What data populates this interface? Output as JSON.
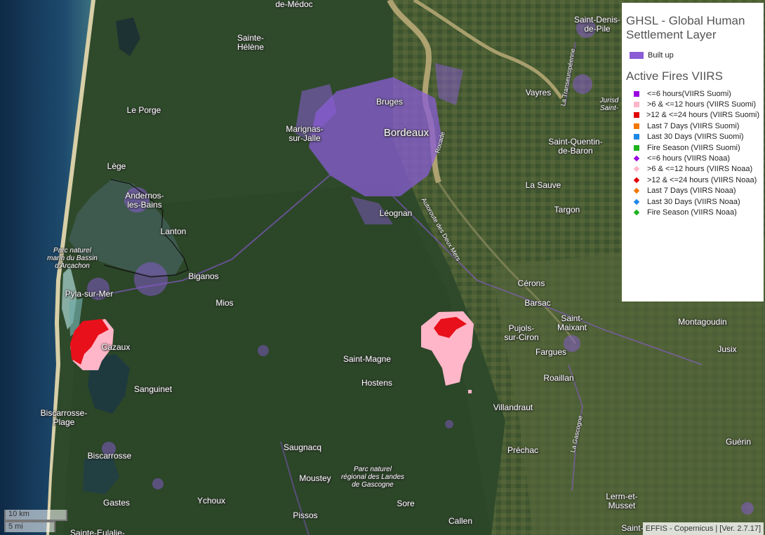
{
  "map": {
    "places": [
      {
        "name": "de-Médoc"
      },
      {
        "name": "Sainte-\nHélène"
      },
      {
        "name": "Saint-Denis-\nde-Pile"
      },
      {
        "name": "Le Porge"
      },
      {
        "name": "Bruges"
      },
      {
        "name": "Bordeaux"
      },
      {
        "name": "Marignas-\nsur-Jalle"
      },
      {
        "name": "Vayres"
      },
      {
        "name": "Jurisd\nSaint-"
      },
      {
        "name": "Saint-Quentin-\nde-Baron"
      },
      {
        "name": "Lège"
      },
      {
        "name": "Andernos-\nles-Bains"
      },
      {
        "name": "La Sauve"
      },
      {
        "name": "Targon"
      },
      {
        "name": "Léognan"
      },
      {
        "name": "Lanton"
      },
      {
        "name": "Parc naturel\nmarin du Bassin\nd'Arcachon"
      },
      {
        "name": "Biganos"
      },
      {
        "name": "Pyla-sur-Mer"
      },
      {
        "name": "Mios"
      },
      {
        "name": "Cérons"
      },
      {
        "name": "Barsac"
      },
      {
        "name": "Saint-\nMaixant"
      },
      {
        "name": "Montagoudin"
      },
      {
        "name": "Pujols-\nsur-Ciron"
      },
      {
        "name": "Jusix"
      },
      {
        "name": "Cazaux"
      },
      {
        "name": "Fargues"
      },
      {
        "name": "Saint-Magne"
      },
      {
        "name": "Hostens"
      },
      {
        "name": "Roaillan"
      },
      {
        "name": "Sanguinet"
      },
      {
        "name": "Villandraut"
      },
      {
        "name": "Biscarrosse-\nPlage"
      },
      {
        "name": "Saugnacq"
      },
      {
        "name": "Préchac"
      },
      {
        "name": "Guérin"
      },
      {
        "name": "Biscarrosse"
      },
      {
        "name": "Parc naturel\nrégional des Landes\nde Gascogne"
      },
      {
        "name": "Moustey"
      },
      {
        "name": "Gastes"
      },
      {
        "name": "Ychoux"
      },
      {
        "name": "Sore"
      },
      {
        "name": "Lerm-et-\nMusset"
      },
      {
        "name": "Pissos"
      },
      {
        "name": "Callen"
      },
      {
        "name": "Sainte-Eulalie-"
      },
      {
        "name": "Saint-"
      }
    ],
    "roads": [
      {
        "name": "La Transeuropéenne"
      },
      {
        "name": "Rocade"
      },
      {
        "name": "Autoroute des Deux Mers"
      },
      {
        "name": "La Gascogne"
      }
    ]
  },
  "legend": {
    "ghsl_title": "GHSL - Global Human Settlement Layer",
    "builtup": {
      "label": "Built up",
      "color": "#8a5cd6"
    },
    "fires_title": "Active Fires VIIRS",
    "fire_items": [
      {
        "label": "<=6 hours(VIIRS Suomi)",
        "shape": "square",
        "color": "#9b00e0"
      },
      {
        "label": ">6 & <=12 hours (VIIRS Suomi)",
        "shape": "square",
        "color": "#ffb6c8"
      },
      {
        "label": ">12 & <=24 hours (VIIRS Suomi)",
        "shape": "square",
        "color": "#e00000"
      },
      {
        "label": "Last 7 Days (VIIRS Suomi)",
        "shape": "square",
        "color": "#f07800"
      },
      {
        "label": "Last 30 Days (VIIRS Suomi)",
        "shape": "square",
        "color": "#1e88e5"
      },
      {
        "label": "Fire Season (VIIRS Suomi)",
        "shape": "square",
        "color": "#1db41d"
      },
      {
        "label": "<=6 hours (VIIRS Noaa)",
        "shape": "diamond",
        "color": "#9b00e0"
      },
      {
        "label": ">6 & <=12 hours (VIIRS Noaa)",
        "shape": "diamond",
        "color": "#ffb6c8"
      },
      {
        "label": ">12 & <=24 hours (VIIRS Noaa)",
        "shape": "diamond",
        "color": "#e00000"
      },
      {
        "label": "Last 7 Days (VIIRS Noaa)",
        "shape": "diamond",
        "color": "#f07800"
      },
      {
        "label": "Last 30 Days (VIIRS Noaa)",
        "shape": "diamond",
        "color": "#1e88e5"
      },
      {
        "label": "Fire Season (VIIRS Noaa)",
        "shape": "diamond",
        "color": "#1db41d"
      }
    ]
  },
  "scale": {
    "km": "10 km",
    "mi": "5 mi"
  },
  "attribution": "EFFIS - Copernicus | [Ver. 2.7.17]"
}
